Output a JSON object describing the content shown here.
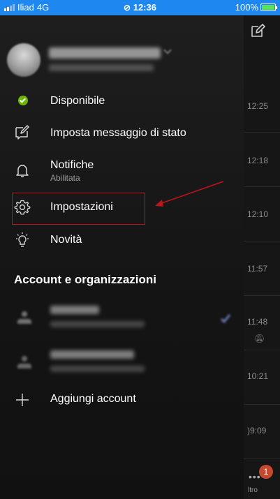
{
  "status_bar": {
    "carrier": "Iliad",
    "network": "4G",
    "time": "12:36",
    "battery": "100%",
    "battery_level": 1.0,
    "bg_color": "#1e88f0"
  },
  "chat_list": {
    "times": [
      "12:25",
      "12:18",
      "12:10",
      "11:57",
      "11:48",
      "10:21",
      ")9:09"
    ],
    "badge_count": "1",
    "more_label": "ltro"
  },
  "drawer": {
    "menu": [
      {
        "label": "Disponibile",
        "icon": "available-status-icon"
      },
      {
        "label": "Imposta messaggio di stato",
        "icon": "status-message-icon"
      },
      {
        "label": "Notifiche",
        "sublabel": "Abilitata",
        "icon": "bell-icon"
      },
      {
        "label": "Impostazioni",
        "icon": "gear-icon"
      },
      {
        "label": "Novità",
        "icon": "lightbulb-icon"
      }
    ],
    "section_title": "Account e organizzazioni",
    "add_account_label": "Aggiungi account"
  },
  "colors": {
    "available_green": "#6bb700",
    "highlight_red": "#c0141b",
    "badge_red": "#c4492f"
  }
}
